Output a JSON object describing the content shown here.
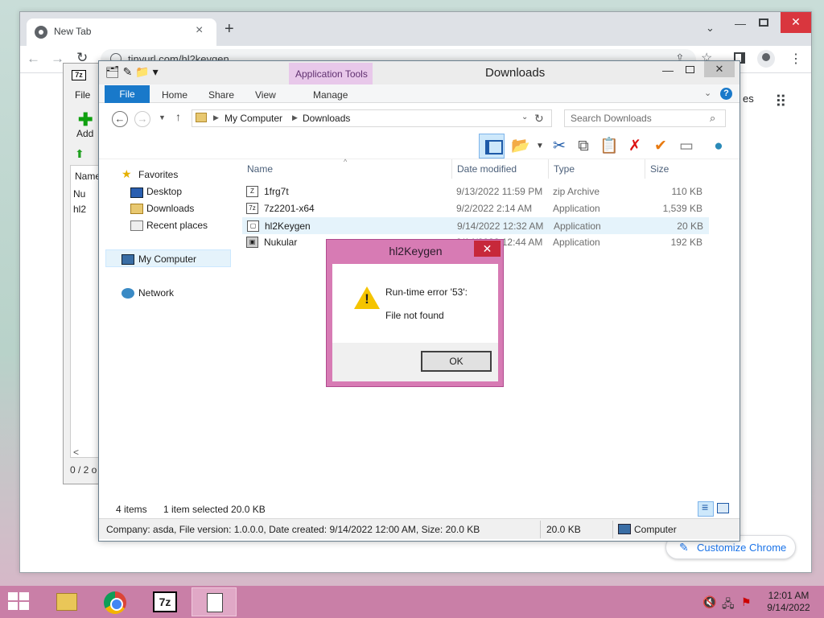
{
  "chrome": {
    "tab_title": "New Tab",
    "url": "tinyurl.com/hl2keygen",
    "images_link": "es",
    "customize_label": "Customize Chrome"
  },
  "zip": {
    "file_menu": "File",
    "add_label": "Add",
    "col_name": "Name",
    "row1": "Nu",
    "row2": "hl2",
    "status": "0 / 2 o"
  },
  "explorer": {
    "title": "Downloads",
    "app_tools": "Application Tools",
    "ribbon_tabs": [
      "File",
      "Home",
      "Share",
      "View",
      "Manage"
    ],
    "breadcrumb": [
      "My Computer",
      "Downloads"
    ],
    "search_placeholder": "Search Downloads",
    "nav": {
      "favorites": "Favorites",
      "desktop": "Desktop",
      "downloads": "Downloads",
      "recent": "Recent places",
      "mycomputer": "My Computer",
      "network": "Network"
    },
    "columns": [
      "Name",
      "Date modified",
      "Type",
      "Size"
    ],
    "files": [
      {
        "name": "1frg7t",
        "date": "9/13/2022 11:59 PM",
        "type": "zip Archive",
        "size": "110 KB"
      },
      {
        "name": "7z2201-x64",
        "date": "9/2/2022 2:14 AM",
        "type": "Application",
        "size": "1,539 KB"
      },
      {
        "name": "hl2Keygen",
        "date": "9/14/2022 12:32 AM",
        "type": "Application",
        "size": "20 KB"
      },
      {
        "name": "Nukular",
        "date": "9/14/2022 12:44 AM",
        "type": "Application",
        "size": "192 KB"
      }
    ],
    "status_count": "4 items",
    "status_selected": "1 item selected  20.0 KB",
    "details_text": "Company: asda, File version: 1.0.0.0, Date created: 9/14/2022 12:00 AM, Size: 20.0 KB",
    "details_size": "20.0 KB",
    "details_location": "Computer"
  },
  "dialog": {
    "title": "hl2Keygen",
    "message1": "Run-time error '53':",
    "message2": "File not found",
    "ok_label": "OK"
  },
  "taskbar": {
    "time": "12:01 AM",
    "date": "9/14/2022",
    "zip_label": "7z"
  }
}
